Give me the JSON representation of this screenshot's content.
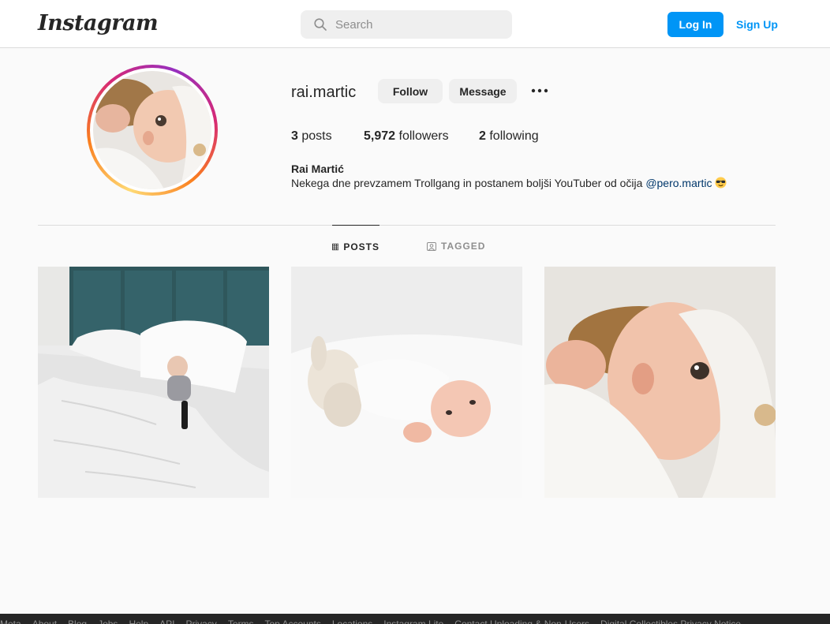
{
  "header": {
    "logo_text": "Instagram",
    "search_placeholder": "Search",
    "login_label": "Log In",
    "signup_label": "Sign Up",
    "accent_color": "#0095f6"
  },
  "profile": {
    "username": "rai.martic",
    "follow_label": "Follow",
    "message_label": "Message",
    "stats": {
      "posts_count": "3",
      "posts_label": "posts",
      "followers_count": "5,972",
      "followers_label": "followers",
      "following_count": "2",
      "following_label": "following"
    },
    "full_name": "Rai Martić",
    "bio_text": "Nekega dne prevzamem Trollgang in postanem boljši YouTuber od očija ",
    "bio_mention": "@pero.martic"
  },
  "tabs": {
    "posts_label": "POSTS",
    "tagged_label": "TAGGED",
    "active": "POSTS"
  },
  "footer": {
    "links": [
      "Meta",
      "About",
      "Blog",
      "Jobs",
      "Help",
      "API",
      "Privacy",
      "Terms",
      "Top Accounts",
      "Locations",
      "Instagram Lite",
      "Contact Uploading & Non-Users",
      "Digital Collectibles Privacy Notice"
    ]
  }
}
